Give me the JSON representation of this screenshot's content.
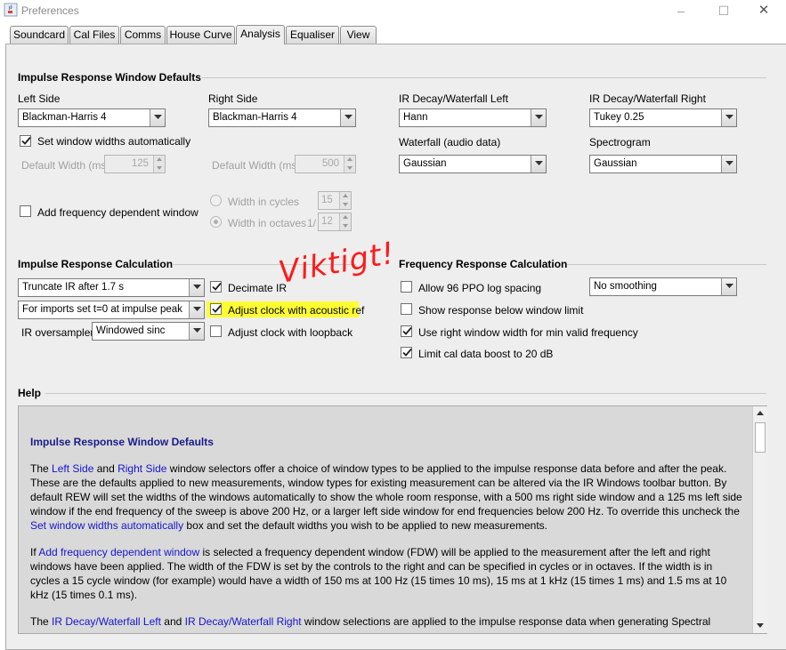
{
  "window": {
    "title": "Preferences",
    "app_icon": "java-cup-icon",
    "minimize_icon": "–",
    "maximize_icon": "☐",
    "close_icon": "✕"
  },
  "tabs": [
    {
      "label": "Soundcard"
    },
    {
      "label": "Cal Files"
    },
    {
      "label": "Comms"
    },
    {
      "label": "House Curve"
    },
    {
      "label": "Analysis",
      "active": true
    },
    {
      "label": "Equaliser"
    },
    {
      "label": "View"
    }
  ],
  "irwd": {
    "title": "Impulse Response Window Defaults",
    "left_side_label": "Left Side",
    "left_side_value": "Blackman-Harris 4",
    "right_side_label": "Right Side",
    "right_side_value": "Blackman-Harris 4",
    "decay_left_label": "IR Decay/Waterfall Left",
    "decay_left_value": "Hann",
    "decay_right_label": "IR Decay/Waterfall Right",
    "decay_right_value": "Tukey 0.25",
    "set_auto_label": "Set window widths automatically",
    "set_auto_checked": true,
    "default_width_left_label": "Default Width (ms)",
    "default_width_left_value": "125",
    "default_width_right_label": "Default Width (ms)",
    "default_width_right_value": "500",
    "waterfall_label": "Waterfall (audio data)",
    "waterfall_value": "Gaussian",
    "spectrogram_label": "Spectrogram",
    "spectrogram_value": "Gaussian",
    "fdw_label": "Add frequency dependent window",
    "fdw_checked": false,
    "width_cycles_label": "Width in cycles",
    "width_cycles_value": "15",
    "width_octaves_label": "Width in octaves",
    "width_octaves_prefix": "1/",
    "width_octaves_value": "12"
  },
  "irc": {
    "title": "Impulse Response Calculation",
    "truncate_value": "Truncate IR after 1.7 s",
    "imports_value": "For imports set t=0 at impulse peak",
    "oversampler_label": "IR oversampler:",
    "oversampler_value": "Windowed sinc",
    "decimate_label": "Decimate IR",
    "decimate_checked": true,
    "adjust_acoustic_label": "Adjust clock with acoustic ref",
    "adjust_acoustic_checked": true,
    "adjust_loopback_label": "Adjust clock with loopback",
    "adjust_loopback_checked": false
  },
  "frc": {
    "title": "Frequency Response Calculation",
    "ppo_label": "Allow 96 PPO log spacing",
    "ppo_checked": false,
    "smoothing_value": "No  smoothing",
    "below_limit_label": "Show response below window limit",
    "below_limit_checked": false,
    "right_window_label": "Use right window width for min valid frequency",
    "right_window_checked": true,
    "limit_cal_label": "Limit cal data boost to 20 dB",
    "limit_cal_checked": true
  },
  "annotation": "Viktigt!",
  "help": {
    "title": "Help",
    "heading": "Impulse Response Window Defaults",
    "p1_a": "The ",
    "p1_link1": "Left Side",
    "p1_b": " and ",
    "p1_link2": "Right Side",
    "p1_c": " window selectors offer a choice of window types to be applied to the impulse response data before and after the peak. These are the defaults applied to new measurements, window types for existing measurement can be altered via the IR Windows toolbar button. By default REW will set the widths of the windows automatically to show the whole room response, with a 500 ms right side window and a 125 ms left side window if the end frequency of the sweep is above 200 Hz, or a larger left side window for end frequencies below 200 Hz. To override this uncheck the ",
    "p1_link3": "Set window widths automatically",
    "p1_d": " box and set the default widths you wish to be applied to new measurements.",
    "p2_a": "If ",
    "p2_link1": "Add frequency dependent window",
    "p2_b": " is selected a frequency dependent window (FDW) will be applied to the measurement after the left and right windows have been applied. The width of the FDW is set by the controls to the right and can be specified in cycles or in octaves. If the width is in cycles a 15 cycle window (for example) would have a width of 150 ms at 100 Hz (15 times 10 ms), 15 ms at 1 kHz (15 times 1 ms) and 1.5 ms at 10 kHz (15 times 0.1 ms).",
    "p3_a": "The ",
    "p3_link1": "IR Decay/Waterfall Left",
    "p3_b": " and ",
    "p3_link2": "IR Decay/Waterfall Right",
    "p3_c": " window selections are applied to the impulse response data when generating Spectral"
  }
}
